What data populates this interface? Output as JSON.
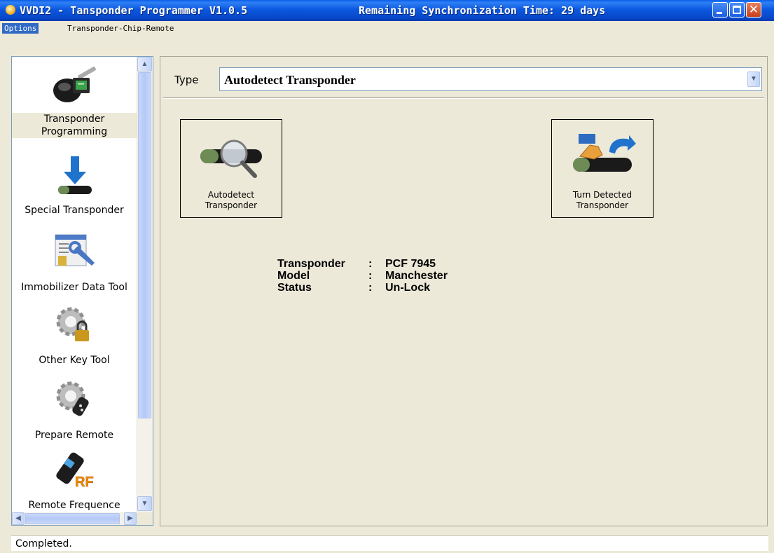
{
  "window": {
    "title": "VVDI2 - Tansponder Programmer V1.0.5",
    "remaining": "Remaining Synchronization Time: 29 days",
    "close_glyph": "✕"
  },
  "menu": {
    "options": "Options",
    "transponder_chip_remote": "Transponder-Chip-Remote"
  },
  "sidebar": {
    "items": [
      {
        "label_lines": [
          "Transponder",
          "Programming"
        ],
        "icon": "car-key-icon",
        "selected": true
      },
      {
        "label": "Special Transponder",
        "icon": "download-transponder-icon"
      },
      {
        "label": "Immobilizer Data Tool",
        "icon": "immobilizer-tool-icon"
      },
      {
        "label": "Other Key Tool",
        "icon": "gear-lock-icon"
      },
      {
        "label": "Prepare Remote",
        "icon": "gear-remote-icon"
      },
      {
        "label": "Remote Frequence",
        "icon": "rf-remote-icon"
      }
    ]
  },
  "main": {
    "type_label": "Type",
    "type_value": "Autodetect Transponder",
    "buttons": {
      "autodetect": [
        "Autodetect",
        "Transponder"
      ],
      "turn_detected": [
        "Turn Detected",
        "Transponder"
      ]
    },
    "info": {
      "rows": [
        {
          "key": "Transponder",
          "sep": ":",
          "value": "PCF 7945"
        },
        {
          "key": "Model",
          "sep": ":",
          "value": "Manchester"
        },
        {
          "key": "Status",
          "sep": ":",
          "value": "Un-Lock"
        }
      ]
    }
  },
  "status": "Completed.",
  "colors": {
    "titlebar": "#0b58df",
    "menu_selected": "#316ac5",
    "panel_bg": "#ece9d8"
  }
}
